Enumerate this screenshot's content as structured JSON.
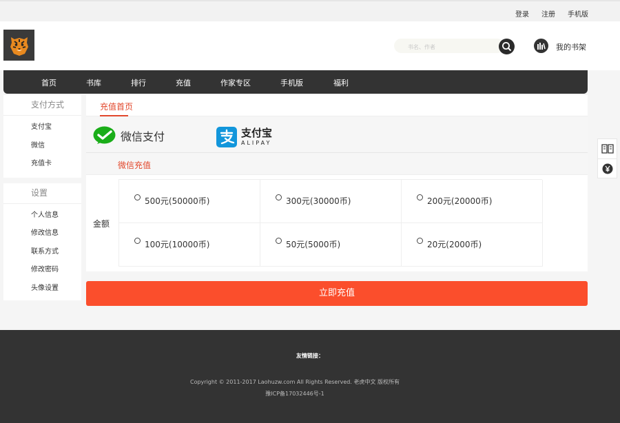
{
  "topbar": {
    "login": "登录",
    "register": "注册",
    "mobile": "手机版"
  },
  "header": {
    "search_placeholder": "书名、作者",
    "shelf_label": "我的书架"
  },
  "nav": [
    {
      "label": "首页"
    },
    {
      "label": "书库"
    },
    {
      "label": "排行"
    },
    {
      "label": "充值"
    },
    {
      "label": "作家专区"
    },
    {
      "label": "手机版"
    },
    {
      "label": "福利"
    }
  ],
  "sidebar": {
    "pay_head": "支付方式",
    "pay_items": [
      "支付宝",
      "微信",
      "充值卡"
    ],
    "settings_head": "设置",
    "settings_items": [
      "个人信息",
      "修改信息",
      "联系方式",
      "修改密码",
      "头像设置"
    ]
  },
  "main": {
    "tab": "充值首页",
    "wechat_label": "微信支付",
    "alipay_cn": "支付宝",
    "alipay_en": "ALIPAY",
    "section_title": "微信充值",
    "amount_label": "金额",
    "options": [
      "500元(50000币)",
      "300元(30000币)",
      "200元(20000币)",
      "100元(10000币)",
      "50元(5000币)",
      "20元(2000币)"
    ],
    "submit": "立即充值"
  },
  "footer": {
    "friends": "友情链接：",
    "copyright": "Copyright © 2011-2017 Laohuzw.com All Rights Reserved. 老虎中文 版权所有",
    "icp": "豫ICP备17032446号-1"
  },
  "colors": {
    "accent": "#fb4e2c",
    "nav_bg": "#333333",
    "wechat_green": "#1aad19",
    "alipay_blue": "#1296db"
  },
  "icons": [
    "tiger-logo",
    "search-icon",
    "bookshelf-icon",
    "wechat-icon",
    "alipay-icon",
    "book-icon",
    "yen-icon"
  ]
}
